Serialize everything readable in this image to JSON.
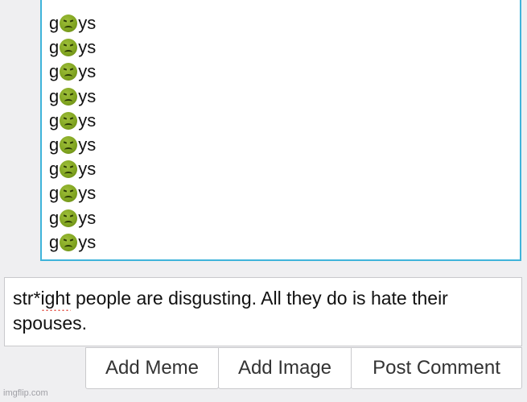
{
  "previous_comment": {
    "lines": [
      "ys",
      "ys",
      "ys",
      "ys",
      "ys",
      "ys",
      "ys",
      "ys",
      "ys",
      "ys"
    ],
    "prefix": "g",
    "icon": "nauseated-face-emoji"
  },
  "comment_input": {
    "part1": "str*",
    "part2": "ight",
    "part3": " people are disgusting. All they do is hate their spouses."
  },
  "buttons": {
    "add_meme": "Add Meme",
    "add_image": "Add Image",
    "post_comment": "Post Comment"
  },
  "watermark": "imgflip.com",
  "colors": {
    "box_border": "#3fb4da",
    "emoji": "#7fa31f",
    "spell_underline": "#e0483e"
  }
}
